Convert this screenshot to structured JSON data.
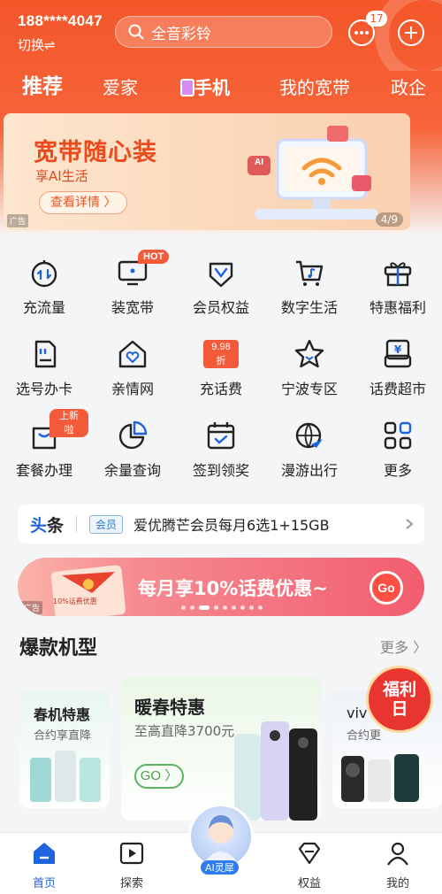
{
  "header": {
    "phone": "188****4047",
    "switch_label": "切换⇌",
    "search_placeholder": "全音彩铃",
    "message_badge": "17"
  },
  "tabs": [
    {
      "label": "推荐",
      "active": true
    },
    {
      "label": "爱家"
    },
    {
      "label": "手机"
    },
    {
      "label": "我的宽带"
    },
    {
      "label": "政企"
    }
  ],
  "banner": {
    "title": "宽带随心装",
    "subtitle": "享AI生活",
    "button": "查看详情 〉",
    "ad_label": "广告",
    "pager": "4/9",
    "ai_badge": "AI"
  },
  "grid": [
    {
      "label": "充流量",
      "icon": "data-drop-icon"
    },
    {
      "label": "装宽带",
      "icon": "monitor-icon",
      "tag": "HOT"
    },
    {
      "label": "会员权益",
      "icon": "vip-diamond-icon"
    },
    {
      "label": "数字生活",
      "icon": "cart-music-icon"
    },
    {
      "label": "特惠福利",
      "icon": "gift-icon"
    },
    {
      "label": "选号办卡",
      "icon": "sim-card-icon"
    },
    {
      "label": "亲情网",
      "icon": "home-heart-icon"
    },
    {
      "label": "充话费",
      "icon": "recharge-icon",
      "tag": "9.98折"
    },
    {
      "label": "宁波专区",
      "icon": "star-icon"
    },
    {
      "label": "话费超市",
      "icon": "bill-shop-icon"
    },
    {
      "label": "套餐办理",
      "icon": "bag-icon",
      "tag": "上新啦"
    },
    {
      "label": "余量查询",
      "icon": "pie-chart-icon"
    },
    {
      "label": "签到领奖",
      "icon": "calendar-check-icon"
    },
    {
      "label": "漫游出行",
      "icon": "globe-plane-icon"
    },
    {
      "label": "更多",
      "icon": "more-grid-icon"
    }
  ],
  "news": {
    "head_a": "头",
    "head_b": "条",
    "tag": "会员",
    "text": "爱优腾芒会员每月6选1+15GB"
  },
  "promo": {
    "text": "每月享10%话费优惠~",
    "go": "Go",
    "ad_label": "广告",
    "card_label": "10%话费优惠"
  },
  "section": {
    "title": "爆款机型",
    "more": "更多 〉"
  },
  "cards": [
    {
      "title": "春机特惠",
      "subtitle": "合约享直降"
    },
    {
      "title": "暖春特惠",
      "subtitle": "至高直降3700元",
      "button": "GO 〉"
    },
    {
      "title": "viv",
      "subtitle": "合约更"
    }
  ],
  "floating": {
    "fuli_line1": "福利",
    "fuli_line2": "日"
  },
  "bottom_nav": [
    {
      "label": "首页",
      "active": true
    },
    {
      "label": "探索"
    },
    {
      "label": "AI灵犀"
    },
    {
      "label": "权益"
    },
    {
      "label": "我的"
    }
  ],
  "colors": {
    "brand": "#f3572a",
    "accent_blue": "#1e64dc"
  }
}
